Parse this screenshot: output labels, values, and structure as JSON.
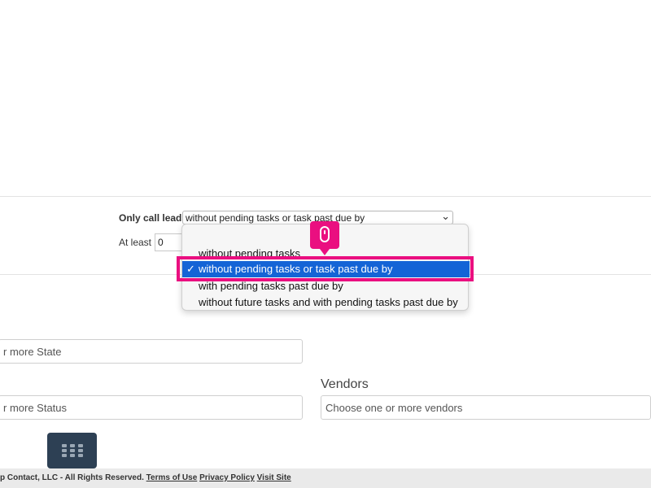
{
  "filters": {
    "only_call_leads_label": "Only call leads",
    "only_call_leads_value": "without pending tasks or task past due by",
    "at_least_label": "At least",
    "at_least_value": "0"
  },
  "dropdown": {
    "options": [
      {
        "label": "without pending tasks",
        "selected": false
      },
      {
        "label": "without pending tasks or task past due by",
        "selected": true
      },
      {
        "label": "with pending tasks past due by",
        "selected": false
      },
      {
        "label": "without future tasks and with pending tasks past due by",
        "selected": false
      }
    ],
    "check_glyph": "✓"
  },
  "fields": {
    "state_placeholder": "r more State",
    "status_placeholder": "r more Status",
    "vendors_label": "Vendors",
    "vendors_placeholder": "Choose one or more vendors"
  },
  "footer": {
    "copyright": "p Contact, LLC - All Rights Reserved.",
    "terms": "Terms of Use",
    "privacy": "Privacy Policy",
    "visit": "Visit Site"
  },
  "colors": {
    "highlight": "#ea0f80",
    "selected_option": "#1464d6",
    "grid_button": "#2d4054"
  },
  "icons": {
    "cursor": "mouse-icon",
    "app_grid": "grid-icon",
    "select_arrow": "chevron-down-icon"
  }
}
